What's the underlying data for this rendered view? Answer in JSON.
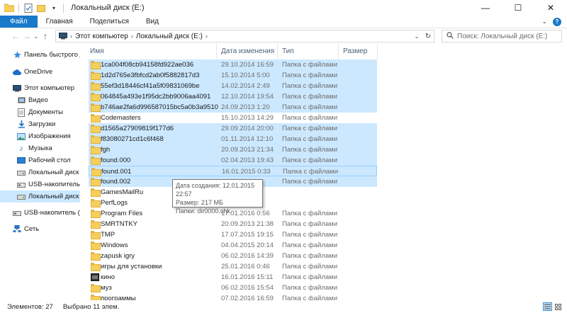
{
  "window": {
    "title": "Локальный диск (E:)",
    "controls": {
      "minimize": "—",
      "maximize": "☐",
      "close": "✕"
    }
  },
  "ribbon": {
    "tabs": [
      {
        "label": "Файл",
        "active": true
      },
      {
        "label": "Главная"
      },
      {
        "label": "Поделиться"
      },
      {
        "label": "Вид"
      }
    ]
  },
  "address": {
    "crumbs": [
      "Этот компьютер",
      "Локальный диск (E:)"
    ],
    "search_placeholder": "Поиск: Локальный диск (E:)"
  },
  "nav": {
    "items": [
      {
        "label": "Панель быстрого до",
        "icon": "star-icon"
      },
      {
        "label": "OneDrive",
        "icon": "cloud-icon"
      },
      {
        "label": "Этот компьютер",
        "icon": "computer-icon"
      },
      {
        "label": "Видео",
        "icon": "video-icon"
      },
      {
        "label": "Документы",
        "icon": "documents-icon"
      },
      {
        "label": "Загрузки",
        "icon": "downloads-icon"
      },
      {
        "label": "Изображения",
        "icon": "pictures-icon"
      },
      {
        "label": "Музыка",
        "icon": "music-icon"
      },
      {
        "label": "Рабочий стол",
        "icon": "desktop-icon"
      },
      {
        "label": "Локальный диск (C",
        "icon": "drive-icon"
      },
      {
        "label": "USB-накопитель (D",
        "icon": "usb-drive-icon"
      },
      {
        "label": "Локальный диск (E",
        "icon": "drive-icon",
        "selected": true
      },
      {
        "label": "USB-накопитель (D:)",
        "icon": "usb-drive-icon"
      },
      {
        "label": "Сеть",
        "icon": "network-icon"
      }
    ]
  },
  "columns": {
    "name": "Имя",
    "date": "Дата изменения",
    "type": "Тип",
    "size": "Размер"
  },
  "files": [
    {
      "name": "1ca004f08cb94158fd922ae036",
      "date": "29.10.2014 16:59",
      "type": "Папка с файлами",
      "selected": true
    },
    {
      "name": "1d2d765e3fbfcd2ab0f5882817d3",
      "date": "15.10.2014 5:00",
      "type": "Папка с файлами",
      "selected": true
    },
    {
      "name": "55ef3d18446cf41a5f09831069be",
      "date": "14.02.2014 2:49",
      "type": "Папка с файлами",
      "selected": true
    },
    {
      "name": "064845a493e1f95dc2bb9006aa4091",
      "date": "12.10.2014 19:54",
      "type": "Папка с файлами",
      "selected": true
    },
    {
      "name": "b746ae2fa6d996587015bc5a0b3a9510",
      "date": "24.09.2013 1:20",
      "type": "Папка с файлами",
      "selected": true
    },
    {
      "name": "Codemasters",
      "date": "15.10.2013 14:29",
      "type": "Папка с файлами"
    },
    {
      "name": "d1565a27909819f177d6",
      "date": "29.09.2014 20:00",
      "type": "Папка с файлами",
      "selected": true
    },
    {
      "name": "f83080271cd1c6f468",
      "date": "01.11.2014 12:10",
      "type": "Папка с файлами",
      "selected": true
    },
    {
      "name": "fgh",
      "date": "20.09.2013 21:34",
      "type": "Папка с файлами",
      "selected": true
    },
    {
      "name": "found.000",
      "date": "02.04.2013 19:43",
      "type": "Папка с файлами",
      "selected": true
    },
    {
      "name": "found.001",
      "date": "16.01.2015 0:33",
      "type": "Папка с файлами",
      "selected": true,
      "focused": true
    },
    {
      "name": "found.002",
      "date": "",
      "type": "Папка с файлами",
      "selected": true
    },
    {
      "name": "GamesMailRu",
      "date": "",
      "type": ""
    },
    {
      "name": "PerfLogs",
      "date": "",
      "type": ""
    },
    {
      "name": "Program Files",
      "date": "17.01.2016 0:56",
      "type": "Папка с файлами"
    },
    {
      "name": "SMRTNTKY",
      "date": "20.09.2013 21:38",
      "type": "Папка с файлами"
    },
    {
      "name": "TMP",
      "date": "17.07.2015 19:15",
      "type": "Папка с файлами"
    },
    {
      "name": "Windows",
      "date": "04.04.2015 20:14",
      "type": "Папка с файлами"
    },
    {
      "name": "zapusk igry",
      "date": "06.02.2016 14:39",
      "type": "Папка с файлами"
    },
    {
      "name": "игры для установки",
      "date": "25.01.2016 0:46",
      "type": "Папка с файлами"
    },
    {
      "name": "кино",
      "date": "16.01.2016 15:11",
      "type": "Папка с файлами",
      "icon": "dark"
    },
    {
      "name": "муз",
      "date": "06.02.2016 15:54",
      "type": "Папка с файлами"
    },
    {
      "name": "программы",
      "date": "07.02.2016 16:59",
      "type": "Папка с файлами"
    }
  ],
  "tooltip": {
    "created": "Дата создания: 12.01.2015 22:57",
    "size": "Размер: 217 МБ",
    "folders": "Папки: dir0000.chk"
  },
  "status": {
    "count": "Элементов: 27",
    "selected": "Выбрано 11 элем."
  },
  "colors": {
    "accent": "#1979ca",
    "selection": "#cce8ff",
    "selection_border": "#99d1ff"
  }
}
